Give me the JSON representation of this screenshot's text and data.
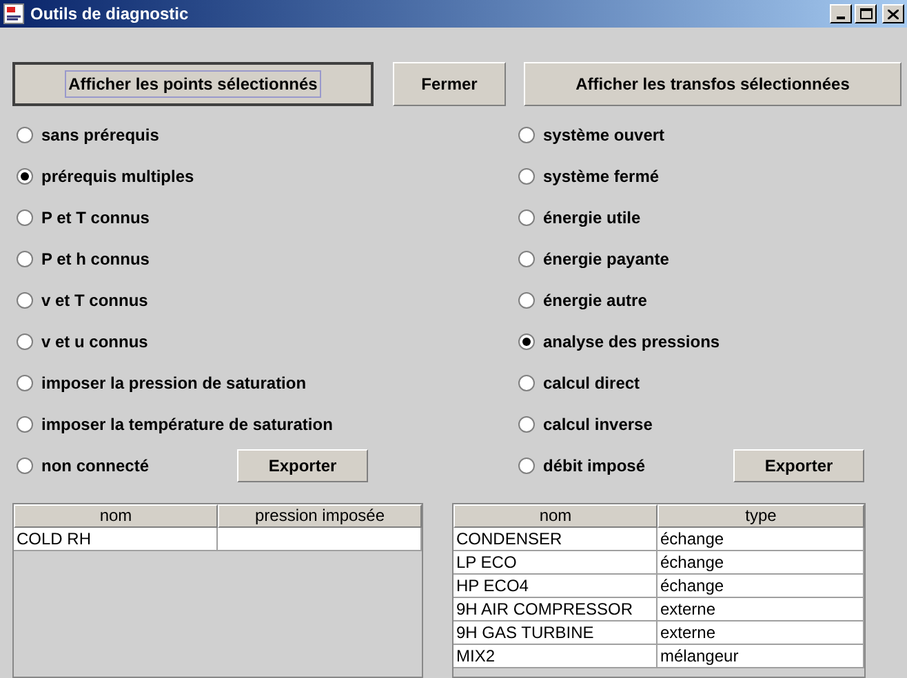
{
  "window": {
    "title": "Outils de diagnostic"
  },
  "buttons": [
    {
      "label": "Afficher les points sélectionnés",
      "focused": true
    },
    {
      "label": "Fermer",
      "focused": false
    },
    {
      "label": "Afficher les transfos sélectionnées",
      "focused": false
    }
  ],
  "left_options": [
    {
      "label": "sans prérequis",
      "selected": false
    },
    {
      "label": "prérequis multiples",
      "selected": true
    },
    {
      "label": "P et T connus",
      "selected": false
    },
    {
      "label": "P et h connus",
      "selected": false
    },
    {
      "label": "v et T connus",
      "selected": false
    },
    {
      "label": "v et u connus",
      "selected": false
    },
    {
      "label": "imposer la pression de saturation",
      "selected": false
    },
    {
      "label": "imposer la température de saturation",
      "selected": false
    },
    {
      "label": "non connecté",
      "selected": false
    }
  ],
  "left_export": "Exporter",
  "right_options": [
    {
      "label": "système ouvert",
      "selected": false
    },
    {
      "label": "système fermé",
      "selected": false
    },
    {
      "label": "énergie utile",
      "selected": false
    },
    {
      "label": "énergie payante",
      "selected": false
    },
    {
      "label": "énergie autre",
      "selected": false
    },
    {
      "label": "analyse des pressions",
      "selected": true
    },
    {
      "label": "calcul direct",
      "selected": false
    },
    {
      "label": "calcul inverse",
      "selected": false
    },
    {
      "label": "débit imposé",
      "selected": false
    }
  ],
  "right_export": "Exporter",
  "left_table": {
    "columns": [
      "nom",
      "pression imposée"
    ],
    "rows": [
      [
        "COLD RH",
        ""
      ]
    ]
  },
  "right_table": {
    "columns": [
      "nom",
      "type"
    ],
    "rows": [
      [
        "CONDENSER",
        "échange"
      ],
      [
        "LP ECO",
        "échange"
      ],
      [
        "HP ECO4",
        "échange"
      ],
      [
        "9H AIR COMPRESSOR",
        "externe"
      ],
      [
        "9H GAS TURBINE",
        "externe"
      ],
      [
        "MIX2",
        "mélangeur"
      ]
    ]
  }
}
